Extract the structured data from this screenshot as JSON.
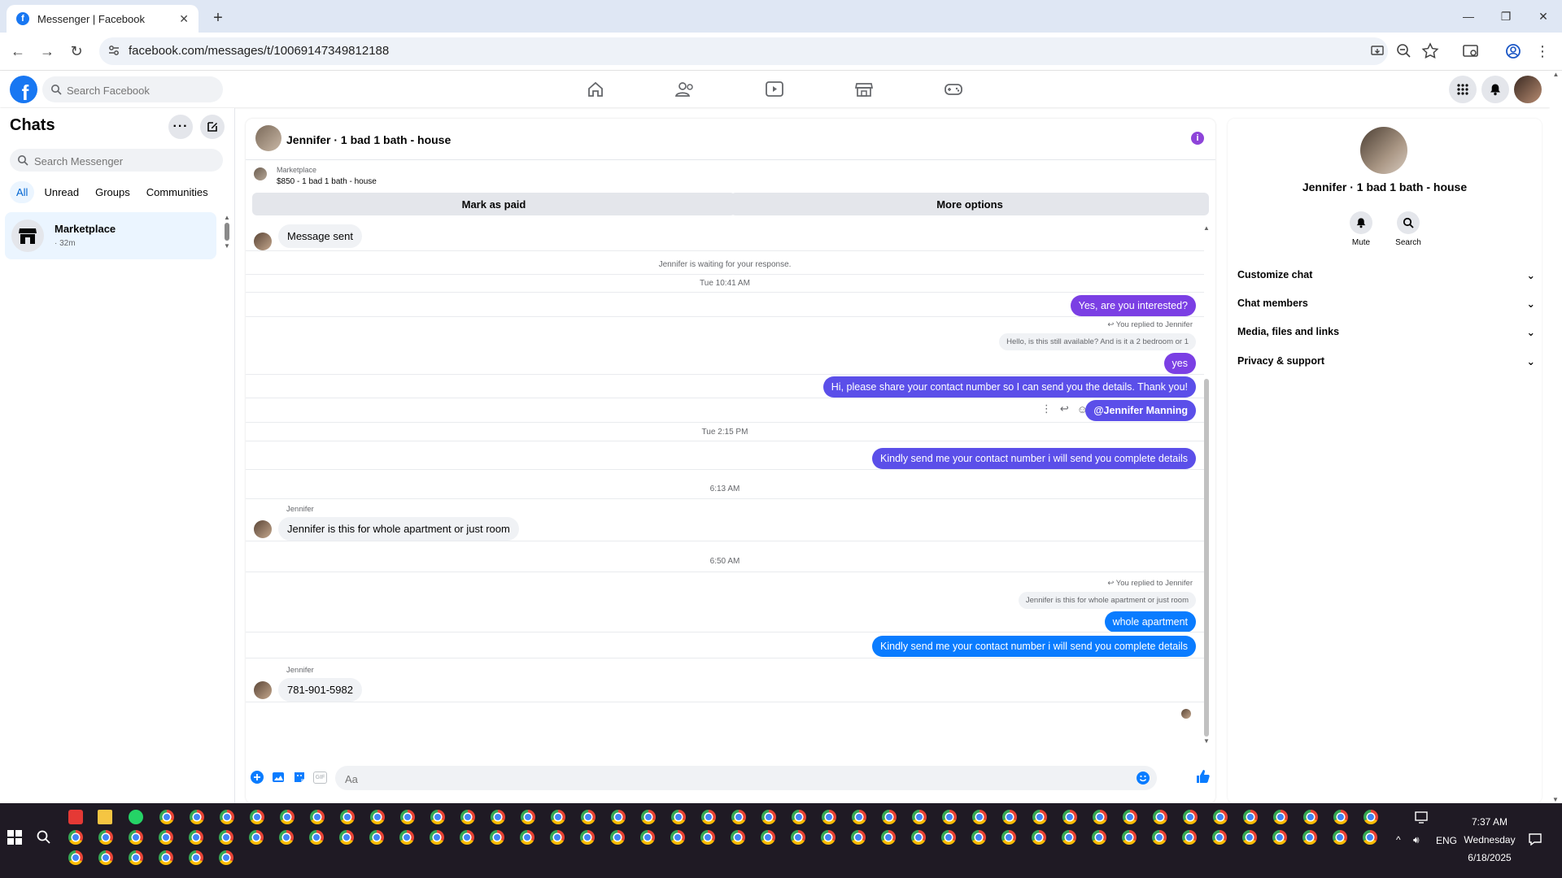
{
  "browser": {
    "tab_title": "Messenger | Facebook",
    "url": "facebook.com/messages/t/10069147349812188"
  },
  "fb": {
    "search_placeholder": "Search Facebook"
  },
  "sidebar": {
    "title": "Chats",
    "search_placeholder": "Search Messenger",
    "filters": [
      "All",
      "Unread",
      "Groups",
      "Communities"
    ],
    "conversation": {
      "name": "Marketplace",
      "time": "· 32m"
    }
  },
  "chat": {
    "title": "Jennifer · 1 bad 1 bath - house",
    "marketplace_label": "Marketplace",
    "listing": "$850 - 1 bad 1 bath - house",
    "mark_paid": "Mark as paid",
    "more_options": "More options",
    "messages": {
      "sent_notice": "Message sent",
      "waiting": "Jennifer is waiting for your response.",
      "ts1": "Tue 10:41 AM",
      "out1": "Yes, are you interested?",
      "replied1": "You replied to Jennifer",
      "quote1": "Hello, is this still available? And is it  a 2 bedroom or 1",
      "out2": "yes",
      "out3": "Hi, please share your contact number so I can send you the details. Thank you!",
      "out4": "@Jennifer Manning",
      "ts2": "Tue 2:15 PM",
      "out5": "Kindly send me your contact number i will send you complete details",
      "ts3": "6:13 AM",
      "sender1": "Jennifer",
      "in1": "Jennifer is this for whole apartment or just room",
      "ts4": "6:50 AM",
      "replied2": "You replied to Jennifer",
      "quote2": "Jennifer is this for whole apartment or just room",
      "out6": "whole  apartment",
      "out7": "Kindly send me your contact number i will send you complete details",
      "sender2": "Jennifer",
      "in2": "781-901-5982"
    },
    "composer_placeholder": "Aa"
  },
  "details": {
    "name": "Jennifer · 1 bad 1 bath - house",
    "mute": "Mute",
    "search": "Search",
    "sections": [
      "Customize chat",
      "Chat members",
      "Media, files and links",
      "Privacy & support"
    ]
  },
  "taskbar": {
    "time": "7:37 AM",
    "day": "Wednesday",
    "date": "6/18/2025",
    "lang": "ENG"
  }
}
